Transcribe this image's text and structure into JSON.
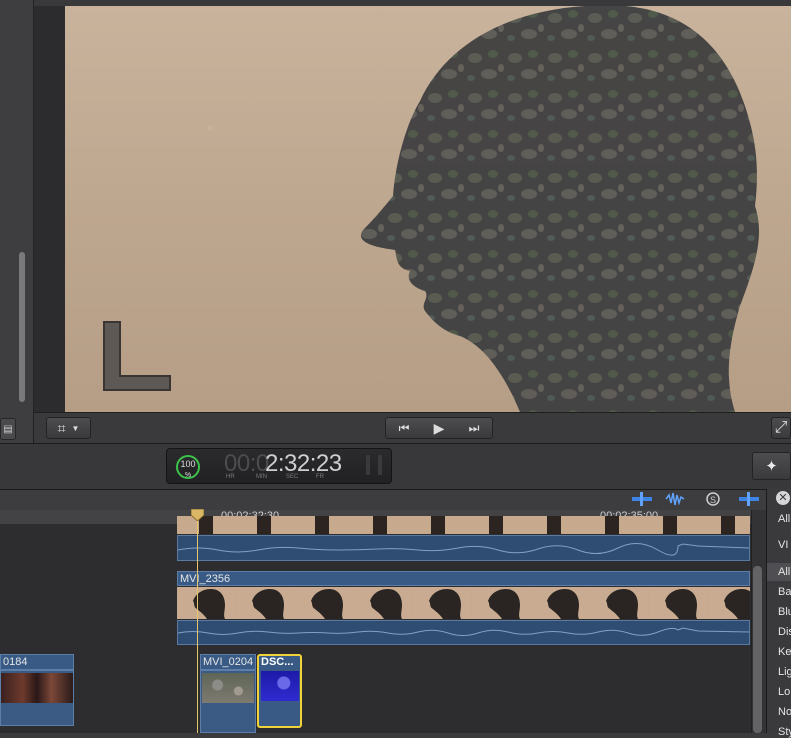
{
  "viewer": {
    "overlay_letter": "L"
  },
  "transport": {
    "prev_label": "⏮",
    "play_label": "▶",
    "next_label": "⏭"
  },
  "timecode": {
    "zoom_percent": "100",
    "percent_sign": "%",
    "dim_digits": "00:0",
    "main_digits": "2:32:23",
    "units": [
      "HR",
      "MIN",
      "SEC",
      "FR"
    ]
  },
  "ruler": {
    "mark1": "00:02:32:30",
    "mark2": "00:02:35:00"
  },
  "clips": {
    "main_clip": "MVI_2356",
    "left_clip": "0184",
    "clip_a": "MVI_0204",
    "clip_b": "DSC..."
  },
  "right_panel": {
    "items": [
      "All",
      "VI",
      "All",
      "Ba",
      "Blu",
      "Dis",
      "Ke",
      "Lig",
      "Lo",
      "No",
      "Sty"
    ]
  },
  "colors": {
    "accent_blue": "#2f6fd8",
    "selection_yellow": "#f0d33a",
    "audio_blue": "#385a84"
  }
}
